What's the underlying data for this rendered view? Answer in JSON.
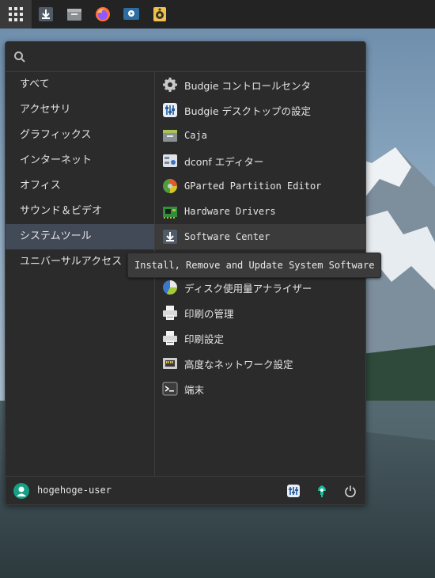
{
  "panel": {
    "launchers": [
      {
        "icon": "software-center-icon"
      },
      {
        "icon": "file-manager-icon"
      },
      {
        "icon": "firefox-icon"
      },
      {
        "icon": "media-player-icon"
      },
      {
        "icon": "speaker-icon"
      }
    ]
  },
  "menu": {
    "search": {
      "value": "",
      "placeholder": ""
    },
    "categories": [
      {
        "label": "すべて",
        "active": false
      },
      {
        "label": "アクセサリ",
        "active": false
      },
      {
        "label": "グラフィックス",
        "active": false
      },
      {
        "label": "インターネット",
        "active": false
      },
      {
        "label": "オフィス",
        "active": false
      },
      {
        "label": "サウンド＆ビデオ",
        "active": false
      },
      {
        "label": "システムツール",
        "active": true
      },
      {
        "label": "ユニバーサルアクセス",
        "active": false
      }
    ],
    "apps": [
      {
        "label": "Budgie コントロールセンタ",
        "icon": "gear-icon"
      },
      {
        "label": "Budgie デスクトップの設定",
        "icon": "budgie-settings-icon"
      },
      {
        "label": "Caja",
        "icon": "file-manager-icon"
      },
      {
        "label": "dconf エディター",
        "icon": "dconf-icon"
      },
      {
        "label": "GParted Partition Editor",
        "icon": "gparted-icon"
      },
      {
        "label": "Hardware Drivers",
        "icon": "hardware-card-icon"
      },
      {
        "label": "Software Center",
        "icon": "download-icon"
      },
      {
        "label": "Install, Remove and Update System Software",
        "icon": "none"
      },
      {
        "label": "ディスク使用量アナライザー",
        "icon": "disk-usage-icon"
      },
      {
        "label": "印刷の管理",
        "icon": "printer-icon"
      },
      {
        "label": "印刷設定",
        "icon": "printer-icon"
      },
      {
        "label": "高度なネットワーク設定",
        "icon": "network-icon"
      },
      {
        "label": "端末",
        "icon": "terminal-icon"
      }
    ],
    "tooltip": "Install, Remove and Update System Software",
    "footer": {
      "username": "hogehoge-user",
      "buttons": [
        "settings-icon",
        "lock-icon",
        "power-icon"
      ]
    }
  }
}
